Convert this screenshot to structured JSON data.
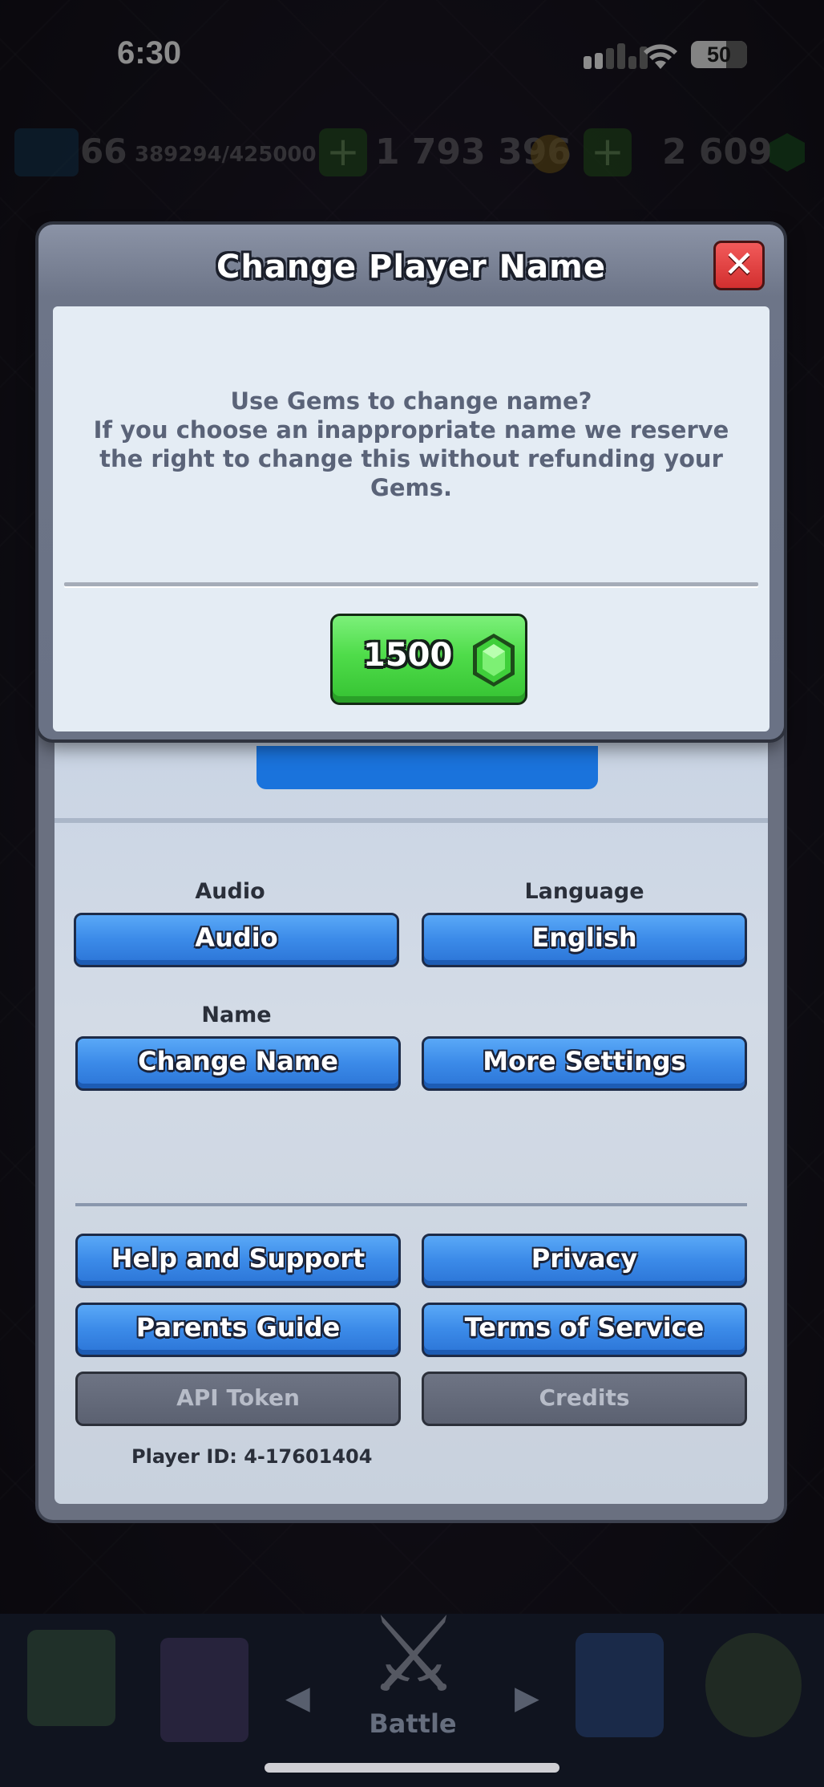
{
  "status_bar": {
    "time": "6:30",
    "battery": "50"
  },
  "resource_bar": {
    "level": "66",
    "xp": "389294/425000",
    "gold": "1 793 396",
    "gems": "2 609"
  },
  "dialog": {
    "title": "Change Player Name",
    "close_icon": "close-icon",
    "message_line1": "Use Gems to change name?",
    "message_line2": "If you choose an inappropriate name we reserve the right to change this without refunding your Gems.",
    "cost_value": "1500",
    "cost_icon": "gem-icon"
  },
  "settings": {
    "audio_label": "Audio",
    "audio_button": "Audio",
    "language_label": "Language",
    "language_button": "English",
    "name_label": "Name",
    "change_name_button": "Change Name",
    "more_settings_button": "More Settings",
    "help_button": "Help and Support",
    "privacy_button": "Privacy",
    "parents_guide_button": "Parents Guide",
    "terms_button": "Terms of Service",
    "api_token_button": "API Token",
    "credits_button": "Credits",
    "player_id": "Player ID: 4-17601404"
  },
  "bottom_nav": {
    "battle_label": "Battle"
  },
  "colors": {
    "primary_blue": "#3b8ae8",
    "gem_green": "#4fdc4a",
    "close_red": "#d22f2f",
    "dialog_body": "#e4ecf4"
  }
}
